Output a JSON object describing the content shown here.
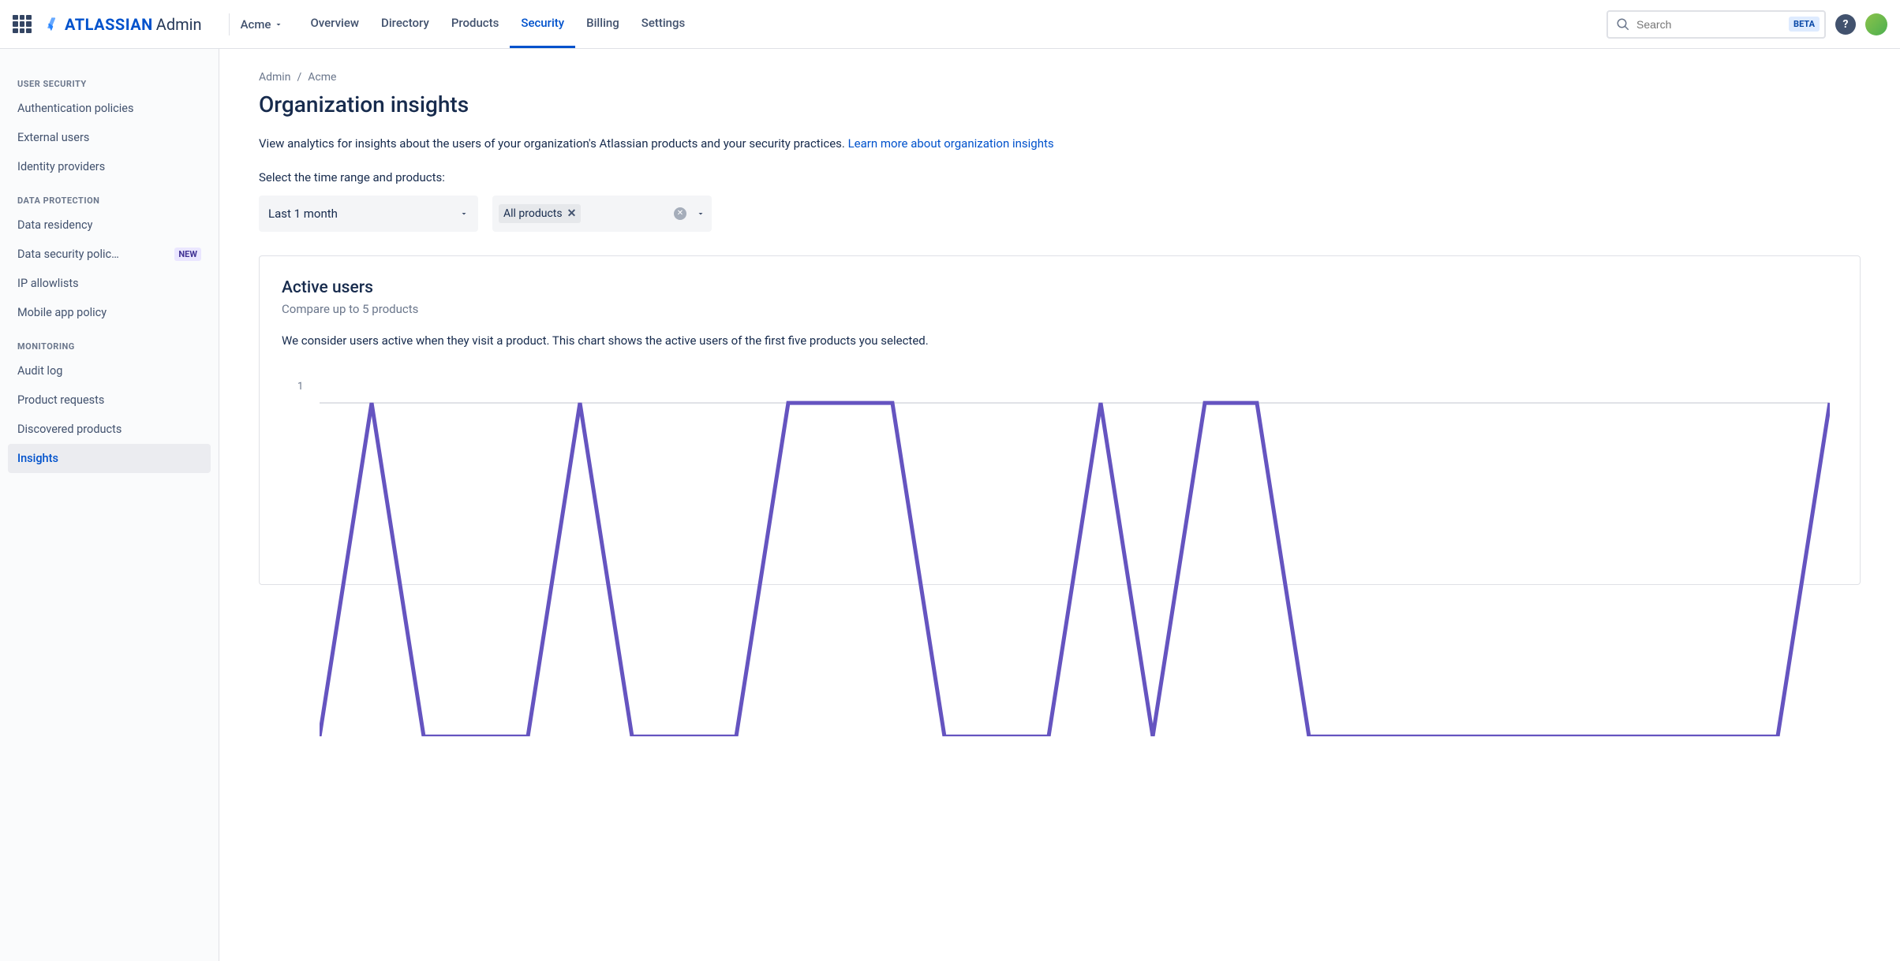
{
  "header": {
    "logo_brand": "ATLASSIAN",
    "logo_suffix": "Admin",
    "org_name": "Acme",
    "nav": [
      "Overview",
      "Directory",
      "Products",
      "Security",
      "Billing",
      "Settings"
    ],
    "nav_active_index": 3,
    "search_placeholder": "Search",
    "beta_label": "BETA"
  },
  "sidebar": {
    "groups": [
      {
        "title": "USER SECURITY",
        "items": [
          {
            "label": "Authentication policies",
            "active": false,
            "badge": null
          },
          {
            "label": "External users",
            "active": false,
            "badge": null
          },
          {
            "label": "Identity providers",
            "active": false,
            "badge": null
          }
        ]
      },
      {
        "title": "DATA PROTECTION",
        "items": [
          {
            "label": "Data residency",
            "active": false,
            "badge": null
          },
          {
            "label": "Data security polic…",
            "active": false,
            "badge": "NEW"
          },
          {
            "label": "IP allowlists",
            "active": false,
            "badge": null
          },
          {
            "label": "Mobile app policy",
            "active": false,
            "badge": null
          }
        ]
      },
      {
        "title": "MONITORING",
        "items": [
          {
            "label": "Audit log",
            "active": false,
            "badge": null
          },
          {
            "label": "Product requests",
            "active": false,
            "badge": null
          },
          {
            "label": "Discovered products",
            "active": false,
            "badge": null
          },
          {
            "label": "Insights",
            "active": true,
            "badge": null
          }
        ]
      }
    ]
  },
  "breadcrumb": {
    "root": "Admin",
    "current": "Acme"
  },
  "page": {
    "title": "Organization insights",
    "intro_text": "View analytics for insights about the users of your organization's Atlassian products and your security practices. ",
    "intro_link": "Learn more about organization insights",
    "select_label": "Select the time range and products:",
    "time_range_value": "Last 1 month",
    "product_tag": "All products"
  },
  "card": {
    "title": "Active users",
    "subtitle": "Compare up to 5 products",
    "description": "We consider users active when they visit a product. This chart shows the active users of the first five products you selected."
  },
  "chart_data": {
    "type": "line",
    "ylabel": "",
    "ylim": [
      0,
      1
    ],
    "y_ticks": [
      1
    ],
    "x": [
      0,
      1,
      2,
      3,
      4,
      5,
      6,
      7,
      8,
      9,
      10,
      11,
      12,
      13,
      14,
      15,
      16,
      17,
      18,
      19,
      20,
      21,
      22,
      23,
      24,
      25,
      26,
      27,
      28,
      29
    ],
    "series": [
      {
        "name": "Active users",
        "color": "#6554c0",
        "values": [
          0,
          1,
          0,
          0,
          0,
          1,
          0,
          0,
          0,
          1,
          1,
          1,
          0,
          0,
          0,
          1,
          0,
          1,
          1,
          0,
          0,
          0,
          0,
          0,
          0,
          0,
          0,
          0,
          0,
          1
        ]
      }
    ]
  }
}
